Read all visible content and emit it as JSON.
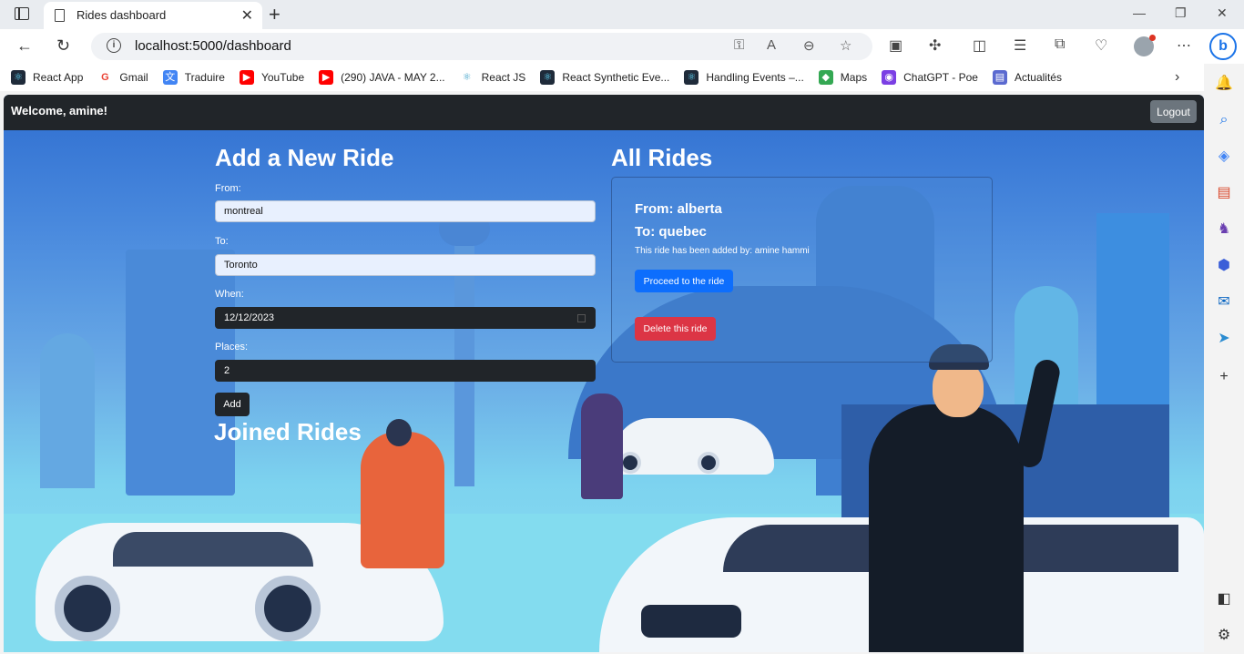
{
  "browser": {
    "tab_title": "Rides dashboard",
    "url": "localhost:5000/dashboard",
    "bookmarks": [
      {
        "label": "React App",
        "icon": "react-icon",
        "color": "#1f2b3a"
      },
      {
        "label": "Gmail",
        "icon": "google-icon",
        "color": "#ea4335"
      },
      {
        "label": "Traduire",
        "icon": "translate-icon",
        "color": "#4285f4"
      },
      {
        "label": "YouTube",
        "icon": "youtube-icon",
        "color": "#ff0000"
      },
      {
        "label": "(290) JAVA - MAY 2...",
        "icon": "youtube-icon",
        "color": "#ff0000"
      },
      {
        "label": "React JS",
        "icon": "react-icon",
        "color": "#1f2b3a"
      },
      {
        "label": "React Synthetic Eve...",
        "icon": "react-icon",
        "color": "#1f2b3a"
      },
      {
        "label": "Handling Events –...",
        "icon": "react-icon",
        "color": "#1f2b3a"
      },
      {
        "label": "Maps",
        "icon": "maps-icon",
        "color": "#34a853"
      },
      {
        "label": "ChatGPT - Poe",
        "icon": "poe-icon",
        "color": "#7b3fe4"
      },
      {
        "label": "Actualités",
        "icon": "news-icon",
        "color": "#5b6ad0"
      }
    ]
  },
  "header": {
    "welcome": "Welcome, amine!",
    "logout_label": "Logout"
  },
  "add_ride": {
    "title": "Add a New Ride",
    "from_label": "From:",
    "from_value": "montreal",
    "to_label": "To:",
    "to_value": "Toronto",
    "when_label": "When:",
    "when_value": "12/12/2023",
    "places_label": "Places:",
    "places_value": "2",
    "add_label": "Add"
  },
  "joined": {
    "title": "Joined Rides"
  },
  "all_rides": {
    "title": "All Rides",
    "rides": [
      {
        "from": "From: alberta",
        "to": "To: quebec",
        "added_by": "This ride has been added by: amine hammi",
        "proceed_label": "Proceed to the ride",
        "delete_label": "Delete this ride"
      }
    ]
  }
}
